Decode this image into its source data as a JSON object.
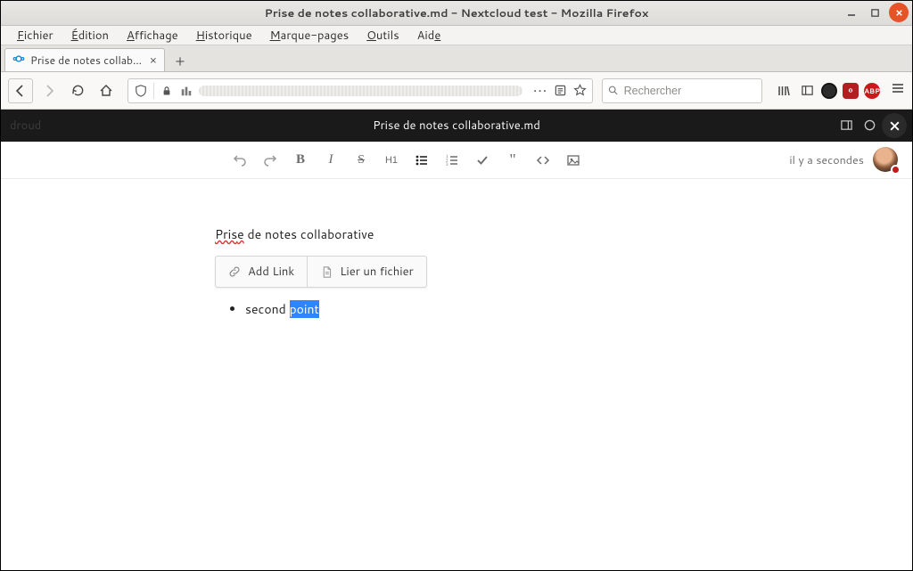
{
  "window": {
    "title": "Prise de notes collaborative.md - Nextcloud test - Mozilla Firefox"
  },
  "menubar": {
    "file": "Fichier",
    "edit": "Édition",
    "view": "Affichage",
    "history": "Historique",
    "bookmarks": "Marque-pages",
    "tools": "Outils",
    "help": "Aide"
  },
  "tab": {
    "label": "Prise de notes collaborat"
  },
  "search": {
    "placeholder": "Rechercher"
  },
  "nc": {
    "brand": "droud",
    "doc_title": "Prise de notes collaborative.md"
  },
  "editor": {
    "status": "il y a secondes",
    "h1_label": "H1"
  },
  "document": {
    "title_prefix": "Pris",
    "title_mid": "e",
    "title_rest": " de notes collaborative",
    "add_link": "Add Link",
    "link_file": "Lier un fichier",
    "bullet_prefix": "second ",
    "bullet_selected": "point"
  }
}
